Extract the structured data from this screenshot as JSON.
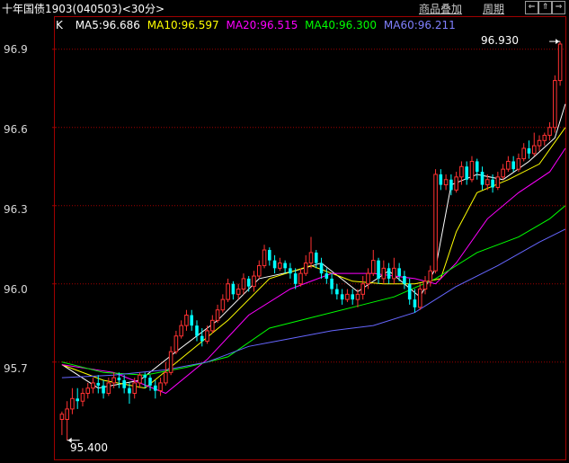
{
  "header": {
    "title": "十年国债1903(040503)<30分>",
    "overlay_btn": "商品叠加",
    "period_btn": "周期",
    "nav_prev": "⇐",
    "nav_up": "⇑",
    "nav_next": "⇒"
  },
  "ma_bar": {
    "k_label": "K",
    "ma5": "MA5:96.686",
    "ma10": "MA10:96.597",
    "ma20": "MA20:96.515",
    "ma40": "MA40:96.300",
    "ma60": "MA60:96.211"
  },
  "colors": {
    "up": "#ff3232",
    "down": "#00ffff",
    "ma5": "#ffffff",
    "ma10": "#ffff00",
    "ma20": "#ff00ff",
    "ma40": "#00ff00",
    "ma60": "#6666ff",
    "grid": "#a00000"
  },
  "chart_data": {
    "type": "candlestick",
    "y_ticks": [
      "96.9",
      "96.6",
      "96.3",
      "96.0",
      "95.7"
    ],
    "ylim": [
      95.33,
      97.02
    ],
    "high_label": "96.930",
    "low_label": "95.400",
    "candles": [
      [
        95.48,
        95.5,
        95.42,
        95.51
      ],
      [
        95.48,
        95.52,
        95.4,
        95.55
      ],
      [
        95.52,
        95.56,
        95.5,
        95.6
      ],
      [
        95.56,
        95.55,
        95.52,
        95.6
      ],
      [
        95.55,
        95.58,
        95.53,
        95.6
      ],
      [
        95.58,
        95.6,
        95.56,
        95.62
      ],
      [
        95.6,
        95.62,
        95.58,
        95.64
      ],
      [
        95.62,
        95.61,
        95.58,
        95.65
      ],
      [
        95.61,
        95.58,
        95.56,
        95.63
      ],
      [
        95.58,
        95.62,
        95.57,
        95.64
      ],
      [
        95.62,
        95.64,
        95.6,
        95.66
      ],
      [
        95.64,
        95.63,
        95.6,
        95.66
      ],
      [
        95.63,
        95.6,
        95.58,
        95.65
      ],
      [
        95.6,
        95.58,
        95.54,
        95.62
      ],
      [
        95.58,
        95.62,
        95.56,
        95.64
      ],
      [
        95.62,
        95.65,
        95.6,
        95.66
      ],
      [
        95.65,
        95.64,
        95.6,
        95.66
      ],
      [
        95.64,
        95.61,
        95.59,
        95.65
      ],
      [
        95.61,
        95.59,
        95.56,
        95.63
      ],
      [
        95.59,
        95.62,
        95.57,
        95.64
      ],
      [
        95.62,
        95.66,
        95.61,
        95.7
      ],
      [
        95.66,
        95.74,
        95.65,
        95.76
      ],
      [
        95.74,
        95.8,
        95.73,
        95.82
      ],
      [
        95.8,
        95.84,
        95.79,
        95.86
      ],
      [
        95.84,
        95.88,
        95.82,
        95.9
      ],
      [
        95.88,
        95.84,
        95.82,
        95.9
      ],
      [
        95.84,
        95.8,
        95.78,
        95.86
      ],
      [
        95.8,
        95.78,
        95.76,
        95.83
      ],
      [
        95.78,
        95.82,
        95.77,
        95.84
      ],
      [
        95.82,
        95.86,
        95.81,
        95.88
      ],
      [
        95.86,
        95.9,
        95.85,
        95.92
      ],
      [
        95.9,
        95.94,
        95.89,
        95.96
      ],
      [
        95.94,
        96.0,
        95.93,
        96.02
      ],
      [
        96.0,
        95.96,
        95.94,
        96.01
      ],
      [
        95.96,
        95.98,
        95.94,
        96.0
      ],
      [
        95.98,
        96.02,
        95.96,
        96.04
      ],
      [
        96.02,
        95.99,
        95.97,
        96.03
      ],
      [
        95.99,
        96.03,
        95.97,
        96.05
      ],
      [
        96.03,
        96.07,
        96.02,
        96.09
      ],
      [
        96.07,
        96.13,
        96.06,
        96.15
      ],
      [
        96.13,
        96.09,
        96.07,
        96.14
      ],
      [
        96.09,
        96.06,
        96.04,
        96.11
      ],
      [
        96.06,
        96.08,
        96.05,
        96.1
      ],
      [
        96.08,
        96.06,
        96.04,
        96.09
      ],
      [
        96.06,
        96.04,
        96.02,
        96.08
      ],
      [
        96.04,
        96.0,
        95.98,
        96.06
      ],
      [
        96.0,
        96.04,
        95.99,
        96.06
      ],
      [
        96.04,
        96.08,
        96.03,
        96.11
      ],
      [
        96.08,
        96.12,
        96.06,
        96.18
      ],
      [
        96.12,
        96.08,
        96.06,
        96.13
      ],
      [
        96.08,
        96.04,
        96.02,
        96.1
      ],
      [
        96.04,
        96.02,
        96.0,
        96.06
      ],
      [
        96.02,
        95.98,
        95.96,
        96.04
      ],
      [
        95.98,
        95.96,
        95.94,
        96.0
      ],
      [
        95.96,
        95.94,
        95.92,
        95.98
      ],
      [
        95.94,
        95.96,
        95.93,
        95.98
      ],
      [
        95.96,
        95.94,
        95.92,
        95.98
      ],
      [
        95.94,
        95.96,
        95.91,
        95.98
      ],
      [
        95.96,
        96.0,
        95.94,
        96.03
      ],
      [
        96.0,
        96.04,
        95.98,
        96.06
      ],
      [
        96.04,
        96.09,
        96.03,
        96.13
      ],
      [
        96.09,
        96.02,
        96.0,
        96.1
      ],
      [
        96.02,
        96.06,
        96.0,
        96.09
      ],
      [
        96.06,
        96.02,
        96.0,
        96.08
      ],
      [
        96.02,
        96.06,
        96.0,
        96.1
      ],
      [
        96.06,
        96.03,
        96.01,
        96.08
      ],
      [
        96.03,
        96.0,
        95.98,
        96.05
      ],
      [
        96.0,
        95.94,
        95.92,
        96.02
      ],
      [
        95.94,
        95.91,
        95.89,
        95.98
      ],
      [
        95.91,
        95.98,
        95.9,
        96.0
      ],
      [
        95.98,
        96.01,
        95.96,
        96.03
      ],
      [
        96.01,
        96.05,
        95.99,
        96.07
      ],
      [
        96.05,
        96.42,
        96.04,
        96.44
      ],
      [
        96.42,
        96.38,
        96.36,
        96.44
      ],
      [
        96.38,
        96.4,
        96.36,
        96.42
      ],
      [
        96.4,
        96.36,
        96.34,
        96.42
      ],
      [
        96.36,
        96.41,
        96.35,
        96.43
      ],
      [
        96.41,
        96.45,
        96.38,
        96.47
      ],
      [
        96.45,
        96.4,
        96.38,
        96.47
      ],
      [
        96.4,
        96.47,
        96.39,
        96.49
      ],
      [
        96.47,
        96.43,
        96.4,
        96.48
      ],
      [
        96.43,
        96.38,
        96.36,
        96.45
      ],
      [
        96.38,
        96.4,
        96.36,
        96.42
      ],
      [
        96.4,
        96.37,
        96.35,
        96.42
      ],
      [
        96.37,
        96.41,
        96.36,
        96.43
      ],
      [
        96.41,
        96.44,
        96.4,
        96.46
      ],
      [
        96.44,
        96.47,
        96.43,
        96.49
      ],
      [
        96.47,
        96.44,
        96.43,
        96.49
      ],
      [
        96.44,
        96.48,
        96.43,
        96.5
      ],
      [
        96.48,
        96.52,
        96.47,
        96.54
      ],
      [
        96.52,
        96.5,
        96.48,
        96.55
      ],
      [
        96.5,
        96.53,
        96.49,
        96.58
      ],
      [
        96.53,
        96.55,
        96.51,
        96.57
      ],
      [
        96.55,
        96.57,
        96.53,
        96.58
      ],
      [
        96.57,
        96.6,
        96.55,
        96.62
      ],
      [
        96.6,
        96.78,
        96.58,
        96.8
      ],
      [
        96.78,
        96.92,
        96.76,
        96.93
      ]
    ],
    "ma_series": [
      {
        "name": "MA5",
        "color": "#ffffff",
        "points": [
          [
            0,
            95.69
          ],
          [
            7,
            95.6
          ],
          [
            15,
            95.63
          ],
          [
            22,
            95.74
          ],
          [
            30,
            95.86
          ],
          [
            38,
            96.02
          ],
          [
            45,
            96.05
          ],
          [
            50,
            96.08
          ],
          [
            57,
            95.97
          ],
          [
            63,
            96.05
          ],
          [
            69,
            95.95
          ],
          [
            72,
            96.06
          ],
          [
            75,
            96.38
          ],
          [
            80,
            96.42
          ],
          [
            85,
            96.4
          ],
          [
            90,
            96.47
          ],
          [
            95,
            96.56
          ],
          [
            97,
            96.69
          ]
        ]
      },
      {
        "name": "MA10",
        "color": "#ffff00",
        "points": [
          [
            0,
            95.69
          ],
          [
            8,
            95.63
          ],
          [
            16,
            95.6
          ],
          [
            24,
            95.73
          ],
          [
            32,
            95.86
          ],
          [
            40,
            96.02
          ],
          [
            48,
            96.07
          ],
          [
            56,
            96.01
          ],
          [
            62,
            96.0
          ],
          [
            68,
            96.0
          ],
          [
            73,
            96.02
          ],
          [
            76,
            96.2
          ],
          [
            80,
            96.35
          ],
          [
            86,
            96.4
          ],
          [
            92,
            96.46
          ],
          [
            97,
            96.6
          ]
        ]
      },
      {
        "name": "MA20",
        "color": "#ff00ff",
        "points": [
          [
            0,
            95.69
          ],
          [
            10,
            95.66
          ],
          [
            20,
            95.58
          ],
          [
            28,
            95.71
          ],
          [
            36,
            95.88
          ],
          [
            44,
            95.98
          ],
          [
            52,
            96.04
          ],
          [
            60,
            96.04
          ],
          [
            68,
            96.02
          ],
          [
            72,
            96.0
          ],
          [
            76,
            96.08
          ],
          [
            82,
            96.25
          ],
          [
            88,
            96.35
          ],
          [
            94,
            96.43
          ],
          [
            97,
            96.52
          ]
        ]
      },
      {
        "name": "MA40",
        "color": "#00ff00",
        "points": [
          [
            0,
            95.7
          ],
          [
            8,
            95.66
          ],
          [
            16,
            95.65
          ],
          [
            24,
            95.68
          ],
          [
            32,
            95.72
          ],
          [
            40,
            95.83
          ],
          [
            48,
            95.87
          ],
          [
            56,
            95.91
          ],
          [
            64,
            95.95
          ],
          [
            72,
            96.02
          ],
          [
            80,
            96.12
          ],
          [
            88,
            96.18
          ],
          [
            94,
            96.25
          ],
          [
            97,
            96.3
          ]
        ]
      },
      {
        "name": "MA60",
        "color": "#6666ff",
        "points": [
          [
            0,
            95.64
          ],
          [
            10,
            95.65
          ],
          [
            20,
            95.67
          ],
          [
            28,
            95.7
          ],
          [
            36,
            95.76
          ],
          [
            44,
            95.79
          ],
          [
            52,
            95.82
          ],
          [
            60,
            95.84
          ],
          [
            68,
            95.89
          ],
          [
            76,
            95.99
          ],
          [
            84,
            96.07
          ],
          [
            92,
            96.16
          ],
          [
            97,
            96.21
          ]
        ]
      }
    ]
  }
}
